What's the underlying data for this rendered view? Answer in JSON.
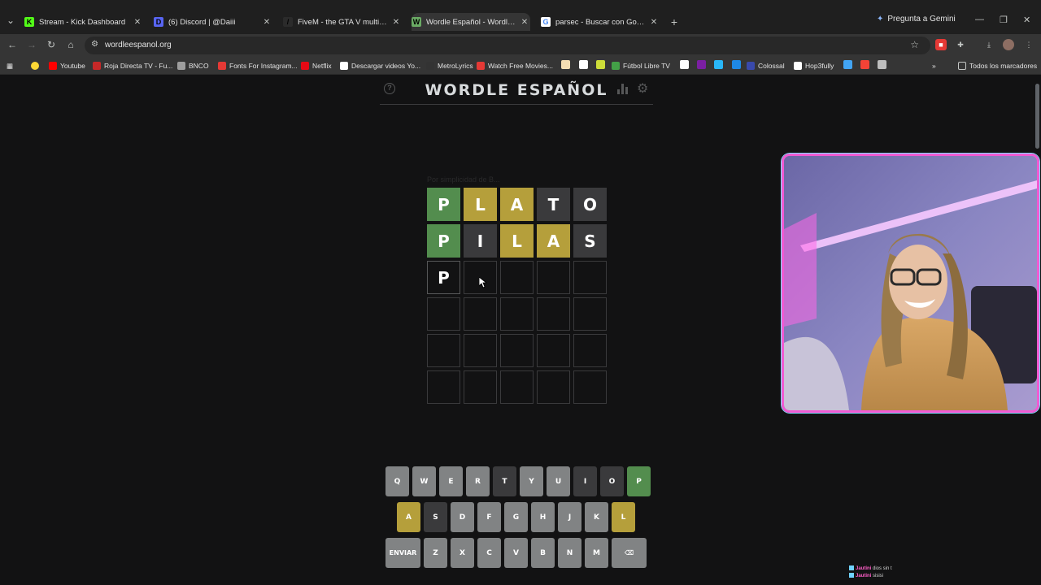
{
  "browser": {
    "tabs": [
      {
        "title": "Stream - Kick Dashboard",
        "favicon_color": "#53fc18",
        "favicon_glyph": "K"
      },
      {
        "title": "(6) Discord | @Daiii",
        "favicon_color": "#5865f2",
        "favicon_glyph": "D"
      },
      {
        "title": "FiveM - the GTA V multiplayer m",
        "favicon_color": "#2b2b2b",
        "favicon_glyph": "/"
      },
      {
        "title": "Wordle Español - Wordle ilimita",
        "favicon_color": "#6aaa64",
        "favicon_glyph": "W"
      },
      {
        "title": "parsec - Buscar con Google",
        "favicon_color": "#ffffff",
        "favicon_glyph": "G"
      }
    ],
    "active_tab_index": 3,
    "gemini_label": "Pregunta a Gemini",
    "url": "wordleespanol.org",
    "bookmarks": [
      {
        "label": "Youtube",
        "color": "#ff0000"
      },
      {
        "label": "Roja Directa TV - Fu...",
        "color": "#c62828"
      },
      {
        "label": "BNCO",
        "color": "#9e9e9e"
      },
      {
        "label": "Fonts For Instagram...",
        "color": "#e53935"
      },
      {
        "label": "Netflix",
        "color": "#e50914"
      },
      {
        "label": "Descargar videos Yo...",
        "color": "#ffffff"
      },
      {
        "label": "MetroLyrics",
        "color": "#333333"
      },
      {
        "label": "Watch Free Movies...",
        "color": "#e53935"
      },
      {
        "label": "Fútbol Libre TV",
        "color": "#43a047"
      },
      {
        "label": "Colossal",
        "color": "#3949ab"
      },
      {
        "label": "Hop3fully",
        "color": "#ffffff"
      }
    ],
    "all_bookmarks_label": "Todos los marcadores"
  },
  "game": {
    "title": "WORDLE ESPAÑOL",
    "faint_text": "Por simplicidad de B...",
    "board": [
      [
        {
          "letter": "P",
          "state": "correct"
        },
        {
          "letter": "L",
          "state": "present"
        },
        {
          "letter": "A",
          "state": "present"
        },
        {
          "letter": "T",
          "state": "absent"
        },
        {
          "letter": "O",
          "state": "absent"
        }
      ],
      [
        {
          "letter": "P",
          "state": "correct"
        },
        {
          "letter": "I",
          "state": "absent"
        },
        {
          "letter": "L",
          "state": "present"
        },
        {
          "letter": "A",
          "state": "present"
        },
        {
          "letter": "S",
          "state": "absent"
        }
      ],
      [
        {
          "letter": "P",
          "state": "tbd"
        },
        {
          "letter": "",
          "state": "empty"
        },
        {
          "letter": "",
          "state": "empty"
        },
        {
          "letter": "",
          "state": "empty"
        },
        {
          "letter": "",
          "state": "empty"
        }
      ],
      [
        {
          "letter": "",
          "state": "empty"
        },
        {
          "letter": "",
          "state": "empty"
        },
        {
          "letter": "",
          "state": "empty"
        },
        {
          "letter": "",
          "state": "empty"
        },
        {
          "letter": "",
          "state": "empty"
        }
      ],
      [
        {
          "letter": "",
          "state": "empty"
        },
        {
          "letter": "",
          "state": "empty"
        },
        {
          "letter": "",
          "state": "empty"
        },
        {
          "letter": "",
          "state": "empty"
        },
        {
          "letter": "",
          "state": "empty"
        }
      ],
      [
        {
          "letter": "",
          "state": "empty"
        },
        {
          "letter": "",
          "state": "empty"
        },
        {
          "letter": "",
          "state": "empty"
        },
        {
          "letter": "",
          "state": "empty"
        },
        {
          "letter": "",
          "state": "empty"
        }
      ]
    ],
    "keyboard": [
      [
        {
          "label": "Q"
        },
        {
          "label": "W"
        },
        {
          "label": "E"
        },
        {
          "label": "R"
        },
        {
          "label": "T",
          "state": "absent"
        },
        {
          "label": "Y"
        },
        {
          "label": "U"
        },
        {
          "label": "I",
          "state": "absent"
        },
        {
          "label": "O",
          "state": "absent"
        },
        {
          "label": "P",
          "state": "correct"
        }
      ],
      [
        {
          "label": "A",
          "state": "present"
        },
        {
          "label": "S",
          "state": "absent"
        },
        {
          "label": "D"
        },
        {
          "label": "F"
        },
        {
          "label": "G"
        },
        {
          "label": "H"
        },
        {
          "label": "J"
        },
        {
          "label": "K"
        },
        {
          "label": "L",
          "state": "present"
        }
      ],
      [
        {
          "label": "ENVIAR",
          "wide": true
        },
        {
          "label": "Z"
        },
        {
          "label": "X"
        },
        {
          "label": "C"
        },
        {
          "label": "V"
        },
        {
          "label": "B"
        },
        {
          "label": "N"
        },
        {
          "label": "M"
        },
        {
          "label": "⌫",
          "wide": true,
          "icon": "backspace-icon"
        }
      ]
    ]
  },
  "overlay": {
    "chat": [
      {
        "name": "Jautini",
        "message": "dios sin t"
      },
      {
        "name": "Jautini",
        "message": "sisisi"
      }
    ]
  },
  "colors": {
    "correct": "#538d4e",
    "present": "#b59f3b",
    "absent": "#3a3a3c",
    "webcam_border": "#f05bd2"
  }
}
